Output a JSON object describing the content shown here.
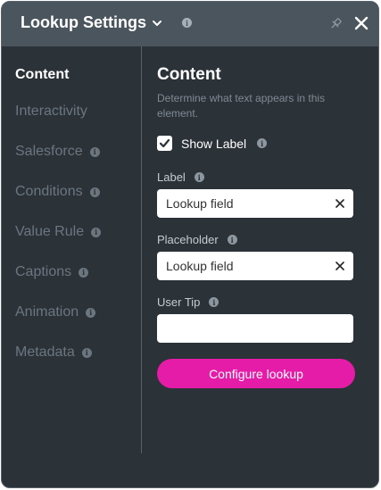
{
  "header": {
    "title": "Lookup Settings",
    "info": "i"
  },
  "sidebar": {
    "items": [
      {
        "label": "Content",
        "active": true,
        "has_info": false
      },
      {
        "label": "Interactivity",
        "active": false,
        "has_info": false
      },
      {
        "label": "Salesforce",
        "active": false,
        "has_info": true
      },
      {
        "label": "Conditions",
        "active": false,
        "has_info": true
      },
      {
        "label": "Value Rule",
        "active": false,
        "has_info": true
      },
      {
        "label": "Captions",
        "active": false,
        "has_info": true
      },
      {
        "label": "Animation",
        "active": false,
        "has_info": true
      },
      {
        "label": "Metadata",
        "active": false,
        "has_info": true
      }
    ],
    "info": "i"
  },
  "main": {
    "title": "Content",
    "description": "Determine what text appears in this element.",
    "show_label": {
      "label": "Show Label",
      "checked": true
    },
    "fields": {
      "label": {
        "label": "Label",
        "value": "Lookup field"
      },
      "placeholder": {
        "label": "Placeholder",
        "value": "Lookup field"
      },
      "user_tip": {
        "label": "User Tip",
        "value": ""
      }
    },
    "configure_button": "Configure lookup"
  },
  "icons": {
    "dropdown": "chevron-down-icon",
    "pin": "pin-icon",
    "close": "close-icon",
    "clear": "clear-icon",
    "check": "check-icon",
    "info": "info-icon"
  },
  "colors": {
    "panel_bg": "#2b3238",
    "header_bg": "#4a555d",
    "accent": "#e51ca8",
    "muted_text": "#6b767f"
  }
}
